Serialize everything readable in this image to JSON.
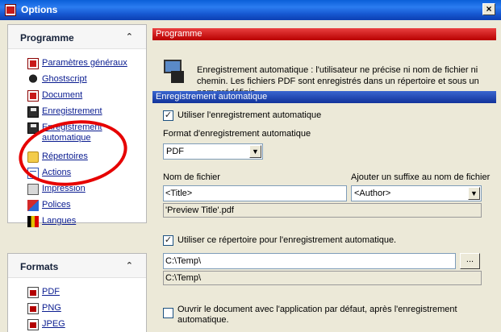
{
  "window": {
    "title": "Options",
    "close_label": "×"
  },
  "sidebar": {
    "programme": {
      "title": "Programme",
      "collapse_glyph": "»",
      "items": [
        {
          "label": "Paramètres généraux",
          "icon": "document-icon"
        },
        {
          "label": "Ghostscript",
          "icon": "ghost-icon"
        },
        {
          "label": "Document",
          "icon": "document-icon"
        },
        {
          "label": "Enregistrement",
          "icon": "save-icon"
        },
        {
          "label": "Enregistrement automatique",
          "icon": "auto-save-icon"
        },
        {
          "label": "Répertoires",
          "icon": "folder-icon"
        },
        {
          "label": "Actions",
          "icon": "list-icon"
        },
        {
          "label": "Impression",
          "icon": "printer-icon"
        },
        {
          "label": "Polices",
          "icon": "font-icon"
        },
        {
          "label": "Langues",
          "icon": "flag-icon"
        }
      ]
    },
    "formats": {
      "title": "Formats",
      "collapse_glyph": "»",
      "items": [
        {
          "label": "PDF",
          "icon": "pdf-icon"
        },
        {
          "label": "PNG",
          "icon": "png-icon"
        },
        {
          "label": "JPEG",
          "icon": "jpeg-icon"
        }
      ]
    }
  },
  "main": {
    "programme_header": "Programme",
    "description": "Enregistrement automatique : l'utilisateur ne précise ni nom de fichier ni chemin. Les fichiers PDF sont enregistrés dans un répertoire et sous un nom prédéfinis.",
    "section_header": "Enregistrement automatique",
    "use_autosave": {
      "label": "Utiliser l'enregistrement automatique",
      "checked": true
    },
    "format_label": "Format d'enregistrement automatique",
    "format_value": "PDF",
    "filename_label": "Nom de fichier",
    "filename_value": "<Title>",
    "suffix_label": "Ajouter un suffixe au nom de fichier",
    "suffix_value": "<Author>",
    "filename_preview": "'Preview Title'.pdf",
    "use_directory": {
      "label": "Utiliser ce répertoire pour l'enregistrement automatique.",
      "checked": true
    },
    "directory_value": "C:\\Temp\\",
    "browse_label": "...",
    "directory_preview": "C:\\Temp\\",
    "open_after": {
      "label": "Ouvrir le document avec l'application par défaut, après l'enregistrement automatique.",
      "checked": false
    }
  }
}
